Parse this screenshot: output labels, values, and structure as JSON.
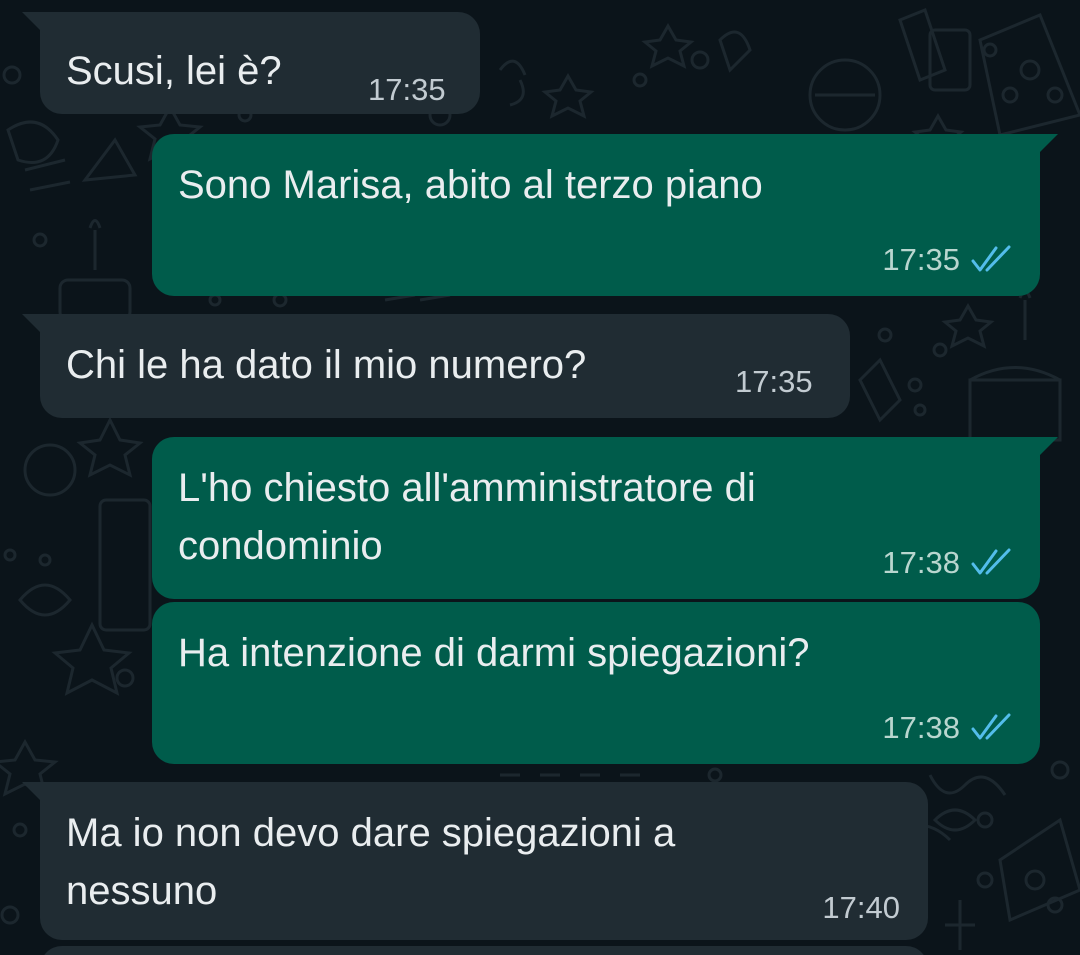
{
  "colors": {
    "background": "#0b141a",
    "incoming_bubble": "#202c33",
    "outgoing_bubble": "#005c4b",
    "read_ticks": "#53bdeb"
  },
  "messages": [
    {
      "direction": "incoming",
      "text": "Scusi, lei è?",
      "time": "17:35"
    },
    {
      "direction": "outgoing",
      "text": "Sono Marisa, abito al terzo piano",
      "time": "17:35",
      "status_icon": "double-check-read-icon"
    },
    {
      "direction": "incoming",
      "text": "Chi le ha dato il mio numero?",
      "time": "17:35"
    },
    {
      "direction": "outgoing",
      "text": "L'ho chiesto all'amministratore di\ncondominio",
      "time": "17:38",
      "status_icon": "double-check-read-icon"
    },
    {
      "direction": "outgoing",
      "text": "Ha intenzione di darmi spiegazioni?",
      "time": "17:38",
      "status_icon": "double-check-read-icon"
    },
    {
      "direction": "incoming",
      "text": "Ma io non devo dare spiegazioni a\nnessuno",
      "time": "17:40"
    }
  ]
}
